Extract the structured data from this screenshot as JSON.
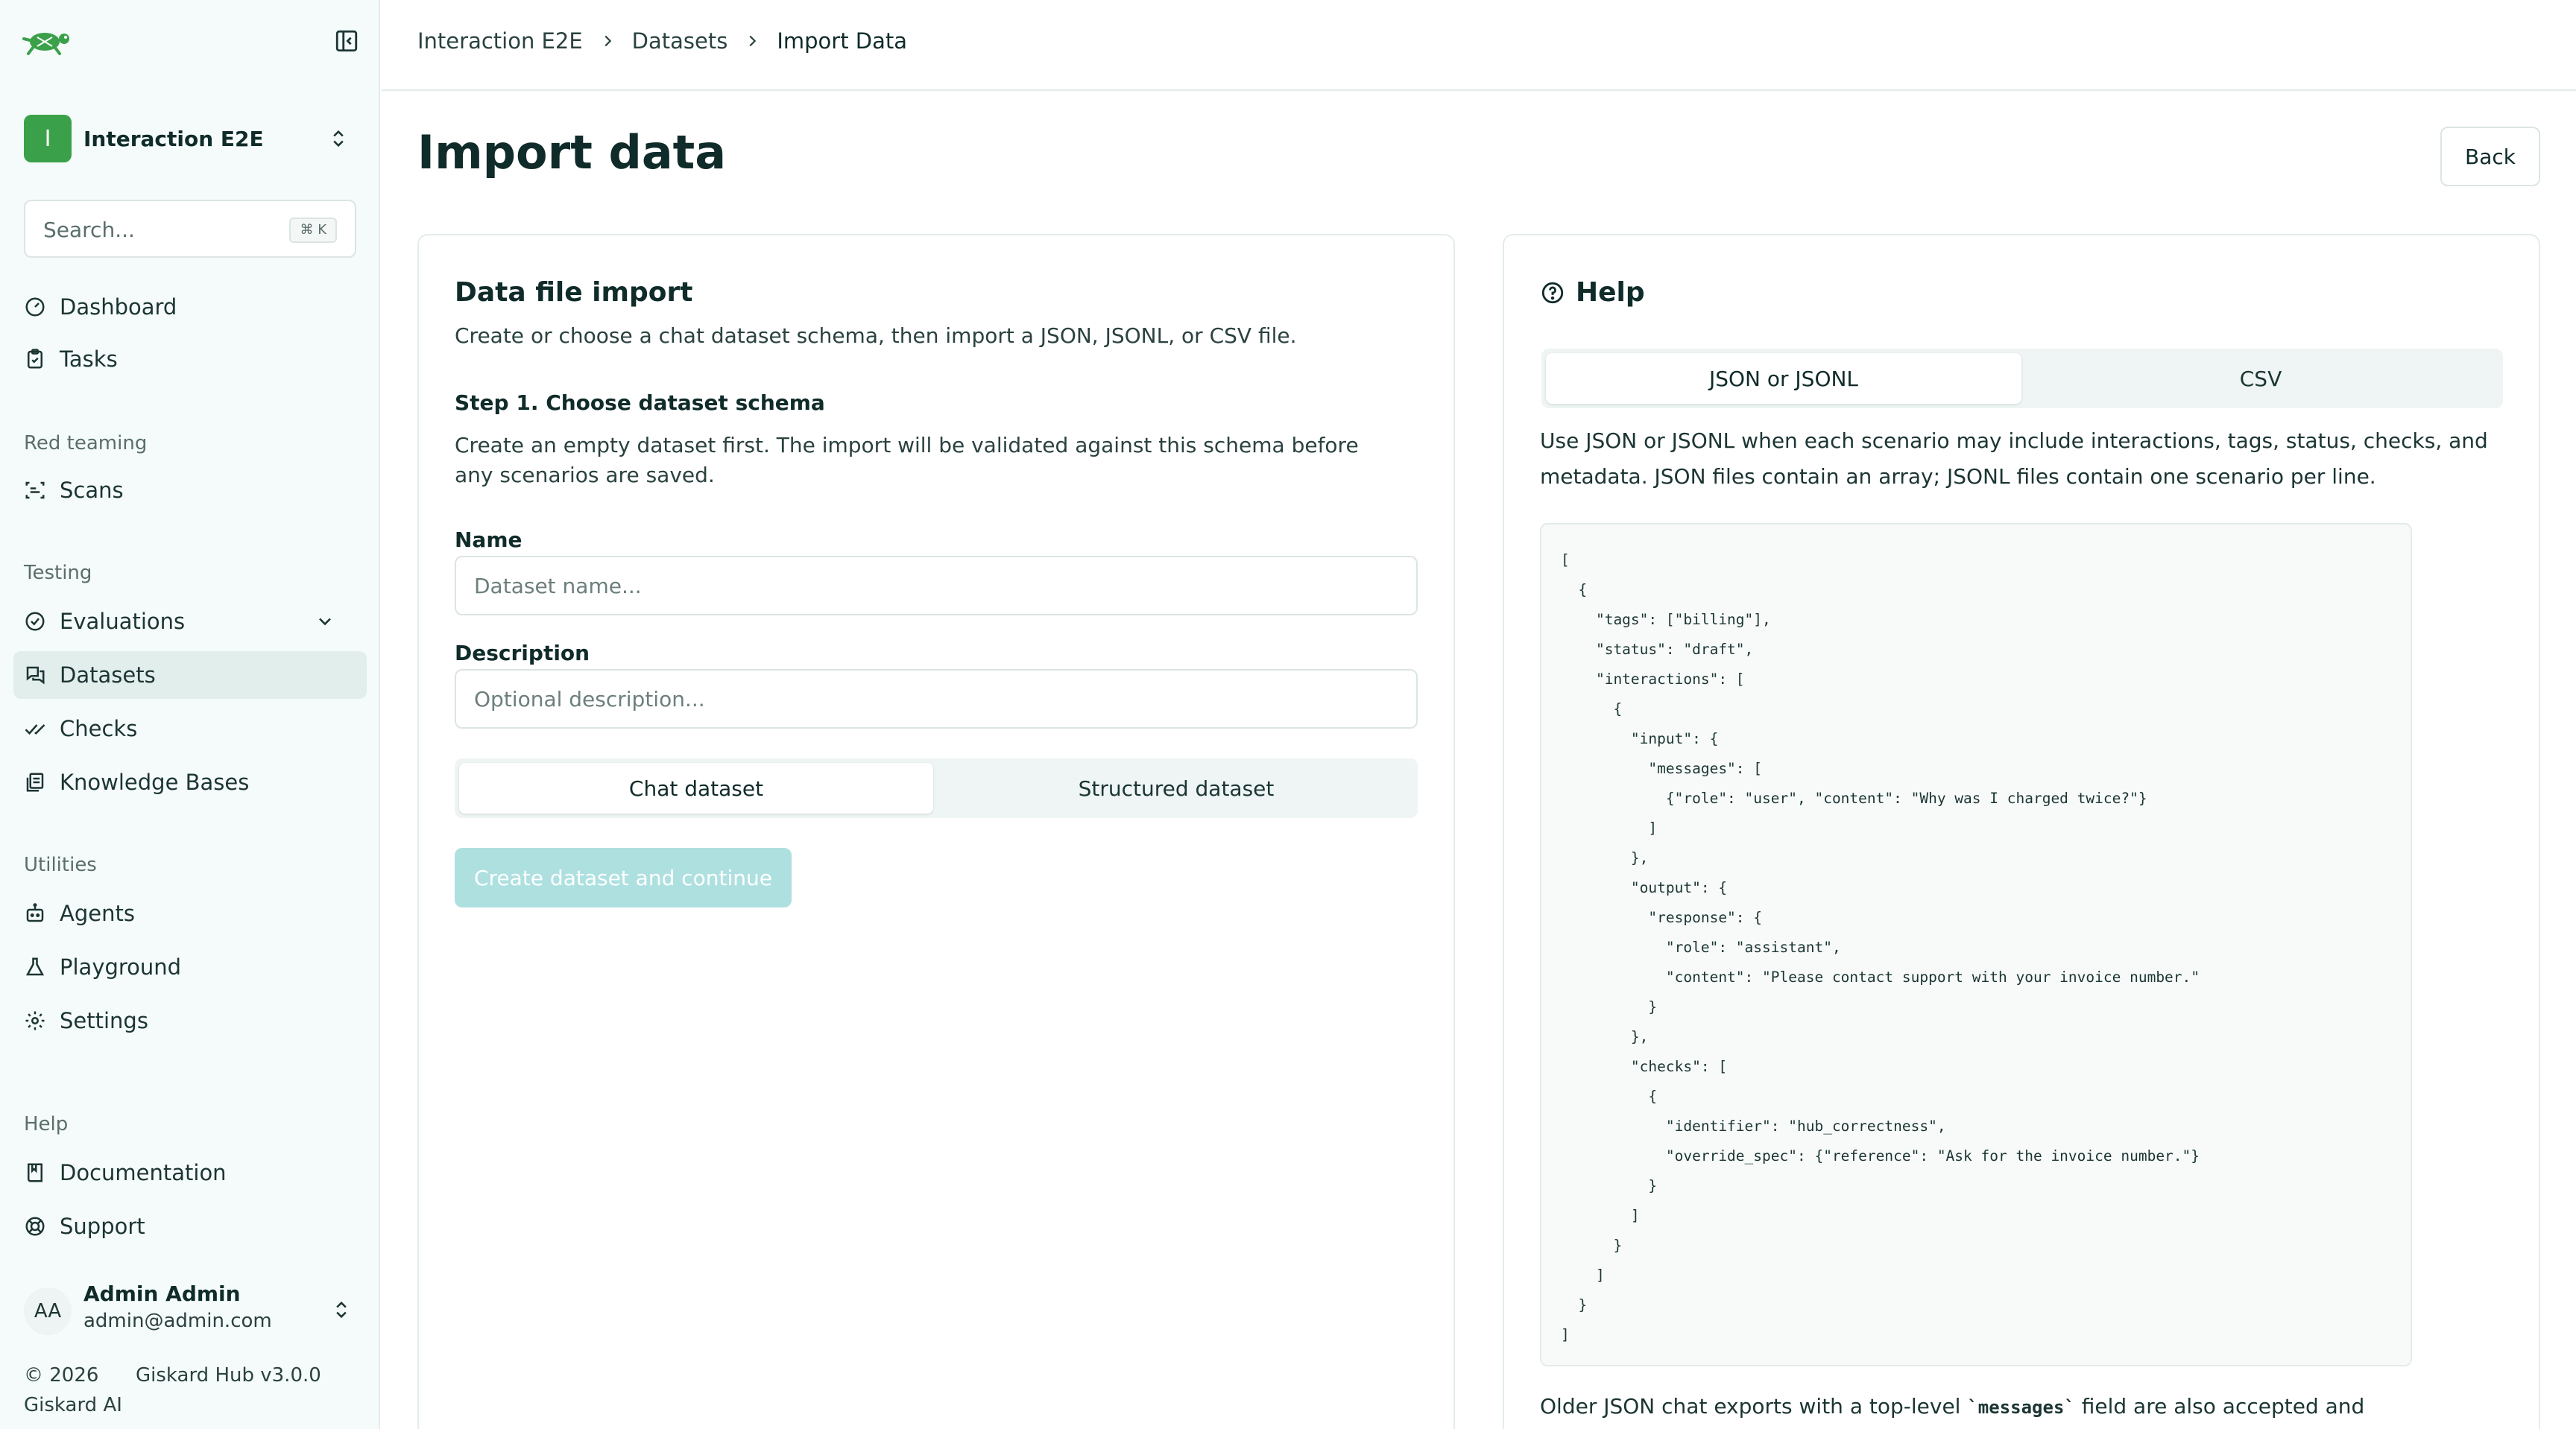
{
  "colors": {
    "accent": "#3aa14a",
    "primary_disabled": "#aee0e0",
    "active_nav": "#e2eeec"
  },
  "sidebar": {
    "workspace": {
      "initial": "I",
      "name": "Interaction E2E"
    },
    "search": {
      "placeholder": "Search...",
      "shortcut": "⌘ K"
    },
    "items_top": [
      {
        "label": "Dashboard",
        "icon": "dashboard-icon"
      },
      {
        "label": "Tasks",
        "icon": "clipboard-icon"
      }
    ],
    "section_red_teaming": "Red teaming",
    "scans_label": "Scans",
    "section_testing": "Testing",
    "evaluations_label": "Evaluations",
    "datasets_label": "Datasets",
    "checks_label": "Checks",
    "knowledge_bases_label": "Knowledge Bases",
    "section_utilities": "Utilities",
    "agents_label": "Agents",
    "playground_label": "Playground",
    "settings_label": "Settings",
    "section_help": "Help",
    "documentation_label": "Documentation",
    "support_label": "Support",
    "user": {
      "initials": "AA",
      "name": "Admin Admin",
      "email": "admin@admin.com"
    },
    "footer": {
      "copyright_line1": "© 2026",
      "copyright_line2": "Giskard AI",
      "version": "Giskard Hub v3.0.0"
    }
  },
  "breadcrumb": {
    "item1": "Interaction E2E",
    "item2": "Datasets",
    "current": "Import Data"
  },
  "page": {
    "title": "Import data",
    "back_label": "Back"
  },
  "import_card": {
    "title": "Data file import",
    "subtitle": "Create or choose a chat dataset schema, then import a JSON, JSONL, or CSV file.",
    "step_title": "Step 1. Choose dataset schema",
    "step_desc": "Create an empty dataset first. The import will be validated against this schema before any scenarios are saved.",
    "name_label": "Name",
    "name_placeholder": "Dataset name...",
    "description_label": "Description",
    "description_placeholder": "Optional description...",
    "type_options": [
      "Chat dataset",
      "Structured dataset"
    ],
    "type_selected": "Chat dataset",
    "create_label": "Create dataset and continue"
  },
  "help_card": {
    "title": "Help",
    "tabs": [
      "JSON or JSONL",
      "CSV"
    ],
    "active_tab": "JSON or JSONL",
    "description": "Use JSON or JSONL when each scenario may include interactions, tags, status, checks, and metadata. JSON files contain an array; JSONL files contain one scenario per line.",
    "code_example": "[\n  {\n    \"tags\": [\"billing\"],\n    \"status\": \"draft\",\n    \"interactions\": [\n      {\n        \"input\": {\n          \"messages\": [\n            {\"role\": \"user\", \"content\": \"Why was I charged twice?\"}\n          ]\n        },\n        \"output\": {\n          \"response\": {\n            \"role\": \"assistant\",\n            \"content\": \"Please contact support with your invoice number.\"\n          }\n        },\n        \"checks\": [\n          {\n            \"identifier\": \"hub_correctness\",\n            \"override_spec\": {\"reference\": \"Ask for the invoice number.\"}\n          }\n        ]\n      }\n    ]\n  }\n]",
    "footer_before": "Older JSON chat exports with a top-level ",
    "footer_code": "`messages`",
    "footer_after": " field are also accepted and"
  }
}
